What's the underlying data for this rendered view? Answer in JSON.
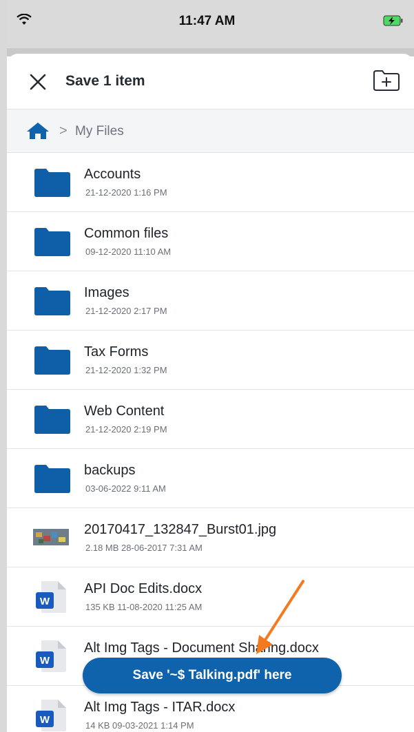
{
  "status_bar": {
    "time": "11:47 AM",
    "wifi_icon": "wifi-icon",
    "battery_icon": "battery-charging-icon"
  },
  "header": {
    "title": "Save 1 item",
    "close_icon": "close-icon",
    "new_folder_icon": "new-folder-icon"
  },
  "breadcrumb": {
    "home_icon": "home-icon",
    "separator": ">",
    "current": "My Files"
  },
  "items": [
    {
      "name": "Accounts",
      "meta": "21-12-2020 1:16 PM",
      "type": "folder"
    },
    {
      "name": "Common files",
      "meta": "09-12-2020 11:10 AM",
      "type": "folder"
    },
    {
      "name": "Images",
      "meta": "21-12-2020 2:17 PM",
      "type": "folder"
    },
    {
      "name": "Tax Forms",
      "meta": "21-12-2020 1:32 PM",
      "type": "folder"
    },
    {
      "name": "Web Content",
      "meta": "21-12-2020 2:19 PM",
      "type": "folder"
    },
    {
      "name": "backups",
      "meta": "03-06-2022 9:11 AM",
      "type": "folder"
    },
    {
      "name": "20170417_132847_Burst01.jpg",
      "meta": "2.18 MB 28-06-2017 7:31 AM",
      "type": "image"
    },
    {
      "name": "API Doc Edits.docx",
      "meta": "135 KB 11-08-2020 11:25 AM",
      "type": "word"
    },
    {
      "name": "Alt Img Tags - Document Sharing.docx",
      "meta": "",
      "type": "word"
    },
    {
      "name": "Alt Img Tags - ITAR.docx",
      "meta": "14 KB 09-03-2021 1:14 PM",
      "type": "word"
    }
  ],
  "save_button": {
    "label": "Save '~$ Talking.pdf' here"
  },
  "colors": {
    "accent": "#0f63ac",
    "folder": "#0f5ea8",
    "annotation_arrow": "#f47a20"
  }
}
